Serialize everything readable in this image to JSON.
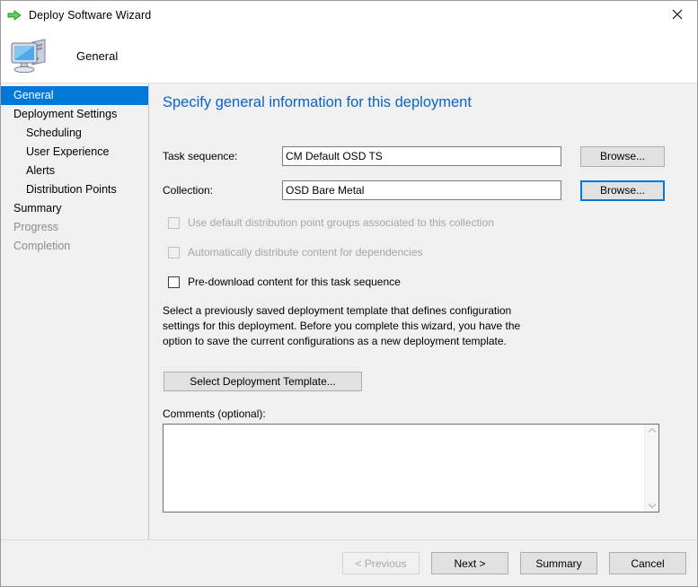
{
  "window": {
    "title": "Deploy Software Wizard",
    "title_icon": "green-arrow-icon",
    "close_icon": "close-icon"
  },
  "banner": {
    "icon": "computer-icon",
    "title": "General"
  },
  "sidebar": {
    "items": [
      {
        "label": "General",
        "state": "selected",
        "indent": false
      },
      {
        "label": "Deployment Settings",
        "state": "enabled",
        "indent": false
      },
      {
        "label": "Scheduling",
        "state": "enabled",
        "indent": true
      },
      {
        "label": "User Experience",
        "state": "enabled",
        "indent": true
      },
      {
        "label": "Alerts",
        "state": "enabled",
        "indent": true
      },
      {
        "label": "Distribution Points",
        "state": "enabled",
        "indent": true
      },
      {
        "label": "Summary",
        "state": "enabled",
        "indent": false
      },
      {
        "label": "Progress",
        "state": "disabled",
        "indent": false
      },
      {
        "label": "Completion",
        "state": "disabled",
        "indent": false
      }
    ]
  },
  "main": {
    "heading": "Specify general information for this deployment",
    "fields": [
      {
        "label": "Task sequence:",
        "value": "CM Default OSD TS",
        "placeholder": "",
        "button_label": "Browse...",
        "button_focused": false
      },
      {
        "label": "Collection:",
        "value": "OSD Bare Metal",
        "placeholder": "",
        "button_label": "Browse...",
        "button_focused": true
      }
    ],
    "checkboxes": [
      {
        "label": "Use default distribution point groups associated to this collection",
        "checked": false,
        "disabled": true
      },
      {
        "label": "Automatically distribute content for dependencies",
        "checked": false,
        "disabled": true
      },
      {
        "label": "Pre-download content for this task sequence",
        "checked": false,
        "disabled": false
      }
    ],
    "description": "Select a previously saved deployment template that defines configuration settings for this deployment. Before you complete this wizard, you have the option to save the current configurations as a new deployment template.",
    "template_button_label": "Select Deployment Template...",
    "comments_label": "Comments (optional):",
    "comments_value": "",
    "comments_placeholder": "",
    "scroll_up_icon": "chevron-up-icon",
    "scroll_down_icon": "chevron-down-icon"
  },
  "footer": {
    "buttons": [
      {
        "label": "< Previous",
        "disabled": true
      },
      {
        "label": "Next >",
        "disabled": false
      },
      {
        "label": "Summary",
        "disabled": false
      },
      {
        "label": "Cancel",
        "disabled": false
      }
    ]
  },
  "colors": {
    "accent": "#0078d7",
    "heading": "#0a63c9",
    "window_bg": "#f0f0f0",
    "disabled_text": "#a6a6a6"
  }
}
